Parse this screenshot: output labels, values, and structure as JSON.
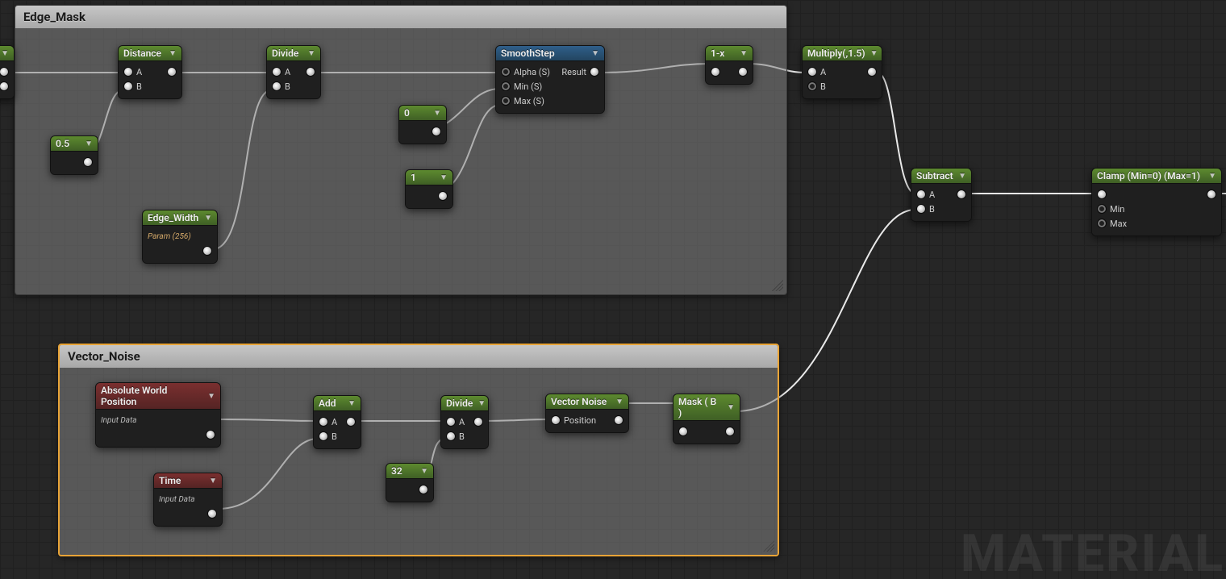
{
  "watermark": "MATERIAL",
  "comments": {
    "edge_mask": {
      "title": "Edge_Mask"
    },
    "vector_noise": {
      "title": "Vector_Noise"
    }
  },
  "nodes": {
    "stub": {
      "pins": {
        "out": ""
      }
    },
    "distance": {
      "title": "Distance",
      "pins": {
        "a": "A",
        "b": "B"
      }
    },
    "const_half": {
      "title": "0.5"
    },
    "edge_width": {
      "title": "Edge_Width",
      "subtitle": "Param (256)"
    },
    "divide1": {
      "title": "Divide",
      "pins": {
        "a": "A",
        "b": "B"
      }
    },
    "const_zero": {
      "title": "0"
    },
    "const_one": {
      "title": "1"
    },
    "smoothstep": {
      "title": "SmoothStep",
      "pins": {
        "alpha": "Alpha (S)",
        "min": "Min (S)",
        "max": "Max (S)",
        "result": "Result"
      }
    },
    "oneminus": {
      "title": "1-x"
    },
    "multiply": {
      "title": "Multiply(,1.5)",
      "pins": {
        "a": "A",
        "b": "B"
      }
    },
    "subtract": {
      "title": "Subtract",
      "pins": {
        "a": "A",
        "b": "B"
      }
    },
    "clamp": {
      "title": "Clamp (Min=0) (Max=1)",
      "pins": {
        "min": "Min",
        "max": "Max"
      }
    },
    "awp": {
      "title": "Absolute World Position",
      "subtitle": "Input Data"
    },
    "time": {
      "title": "Time",
      "subtitle": "Input Data"
    },
    "add": {
      "title": "Add",
      "pins": {
        "a": "A",
        "b": "B"
      }
    },
    "const_32": {
      "title": "32"
    },
    "divide2": {
      "title": "Divide",
      "pins": {
        "a": "A",
        "b": "B"
      }
    },
    "vnoise": {
      "title": "Vector Noise",
      "pins": {
        "position": "Position"
      }
    },
    "maskb": {
      "title": "Mask ( B )"
    }
  }
}
